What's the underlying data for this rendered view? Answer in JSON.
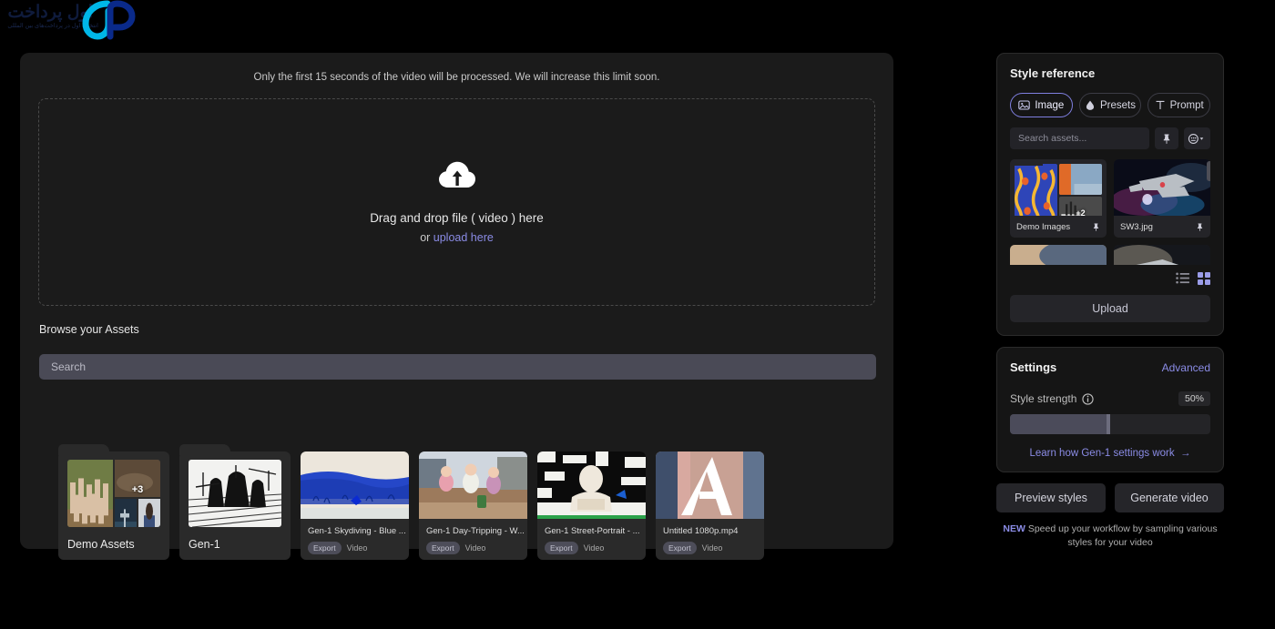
{
  "brand": {
    "logo_text": "اول پرداخت",
    "logo_subtext": "انتخاب اول در پرداخت‌های بین المللی",
    "logo_mark": "AP",
    "accent_color": "#00b7e8"
  },
  "main": {
    "limit_note": "Only the first 15 seconds of the video will be processed. We will increase this limit soon.",
    "dropzone": {
      "icon": "cloud-upload-icon",
      "primary_text": "Drag and drop file ( video ) here",
      "secondary_prefix": "or ",
      "secondary_link": "upload here"
    },
    "browse_title": "Browse your Assets",
    "search_placeholder": "Search",
    "search_value": "",
    "assets": [
      {
        "kind": "folder",
        "label": "Demo Assets",
        "overflow_badge": "+3"
      },
      {
        "kind": "folder",
        "label": "Gen-1",
        "overflow_badge": ""
      },
      {
        "kind": "video",
        "label": "Gen-1 Skydiving - Blue ...",
        "badge": "Export",
        "type": "Video"
      },
      {
        "kind": "video",
        "label": "Gen-1 Day-Tripping - W...",
        "badge": "Export",
        "type": "Video"
      },
      {
        "kind": "video",
        "label": "Gen-1 Street-Portrait - ...",
        "badge": "Export",
        "type": "Video"
      },
      {
        "kind": "video",
        "label": "Untitled 1080p.mp4",
        "badge": "Export",
        "type": "Video"
      }
    ]
  },
  "sidebar": {
    "style_reference": {
      "title": "Style reference",
      "modes": [
        {
          "label": "Image",
          "icon": "image-icon",
          "active": true
        },
        {
          "label": "Presets",
          "icon": "droplet-icon",
          "active": false
        },
        {
          "label": "Prompt",
          "icon": "text-t-icon",
          "active": false
        }
      ],
      "search_placeholder": "Search assets...",
      "search_value": "",
      "pin_icon": "pin-icon",
      "filter_icon": "filter-dropdown-icon",
      "items": [
        {
          "name": "Demo Images",
          "pin_icon": "pin-icon",
          "overflow_badge": "+2",
          "kind": "folder"
        },
        {
          "name": "SW3.jpg",
          "pin_icon": "pin-icon",
          "overflow_badge": "",
          "kind": "image"
        }
      ],
      "view_toggle": [
        {
          "icon": "list-view-icon",
          "active": false
        },
        {
          "icon": "grid-view-icon",
          "active": true
        }
      ],
      "upload_label": "Upload"
    },
    "settings": {
      "title": "Settings",
      "advanced_label": "Advanced",
      "style_strength_label": "Style strength",
      "info_icon": "info-icon",
      "style_strength_value": "50%",
      "style_strength_percent": 50,
      "learn_link": "Learn how Gen-1 settings work",
      "learn_link_icon": "arrow-right-icon"
    },
    "actions": {
      "preview_label": "Preview styles",
      "generate_label": "Generate video"
    },
    "footer_note": {
      "tag": "NEW",
      "text": " Speed up your workflow by sampling various styles for your video"
    }
  }
}
